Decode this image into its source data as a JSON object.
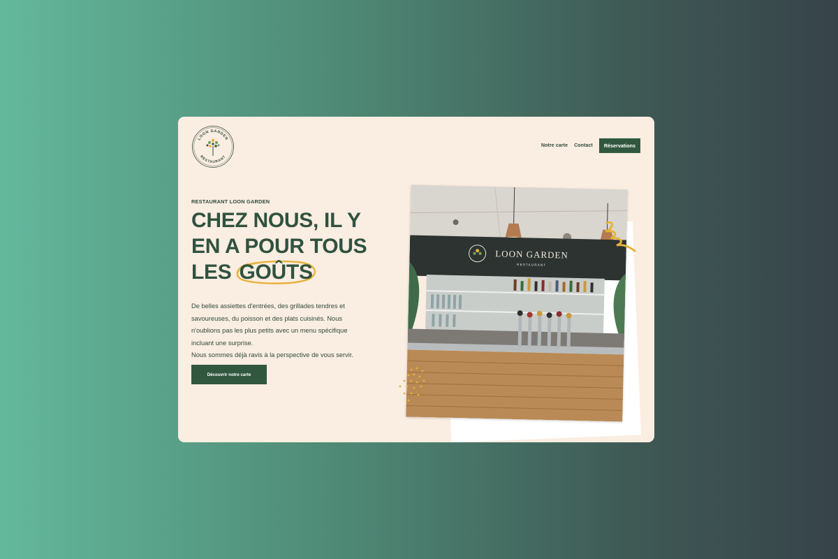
{
  "colors": {
    "brand_green": "#31583f",
    "headline_green": "#2f523f",
    "card_bg": "#faede1",
    "accent_gold": "#e6b23a"
  },
  "logo": {
    "name_arc": "LOON GARDEN",
    "sub_arc": "RESTAURANT"
  },
  "nav": {
    "links": [
      "Notre carte",
      "Contact"
    ],
    "cta_label": "Réservations"
  },
  "hero": {
    "eyebrow": "RESTAURANT LOON GARDEN",
    "headline_lines": [
      "CHEZ NOUS, IL Y",
      "EN A POUR TOUS",
      "LES "
    ],
    "headline_highlight": "GOÛTS",
    "description_lines": [
      "De belles assiettes d'entrées, des grillades tendres et",
      "savoureuses, du poisson et des plats cuisinés. Nous",
      "n'oublions pas les plus petits avec un menu spécifique",
      "incluant une surprise.",
      "Nous sommes déjà ravis à la perspective de vous servir."
    ],
    "cta_label": "Découvrir notre carte"
  },
  "photo": {
    "sign_title": "LOON GARDEN",
    "sign_sub": "RESTAURANT"
  }
}
